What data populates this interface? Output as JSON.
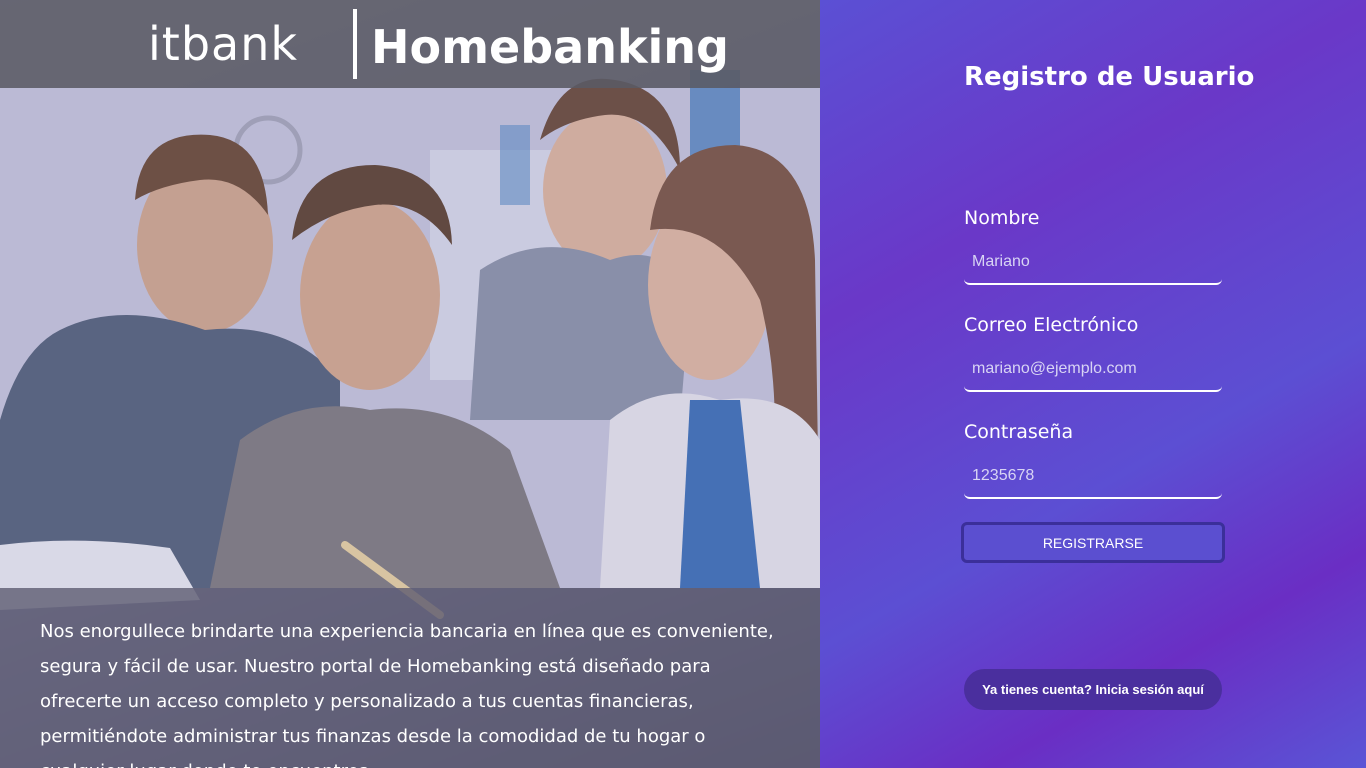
{
  "header": {
    "logo_text": "itbank",
    "title": "Homebanking"
  },
  "hero": {
    "photo_description_icon": "people-laptop-photo",
    "caption": "Nos enorgullece brindarte una experiencia bancaria en línea que es conveniente, segura y fácil de usar. Nuestro portal de Homebanking está diseñado para ofrecerte un acceso completo y personalizado a tus cuentas financieras, permitiéndote administrar tus finanzas desde la comodidad de tu hogar o cualquier lugar donde te encuentres."
  },
  "form": {
    "title": "Registro de Usuario",
    "fields": {
      "name": {
        "label": "Nombre",
        "value": "Mariano"
      },
      "email": {
        "label": "Correo Electrónico",
        "value": "mariano@ejemplo.com"
      },
      "password": {
        "label": "Contraseña",
        "value": "1235678"
      }
    },
    "submit_label": "REGISTRARSE",
    "login_link": "Ya tienes cuenta? Inicia sesión aquí"
  },
  "colors": {
    "panel_primary": "#5b50d4",
    "panel_secondary": "#6a2ec4",
    "button_border": "#3b2f9a",
    "link_bg": "#4a2f9e"
  }
}
